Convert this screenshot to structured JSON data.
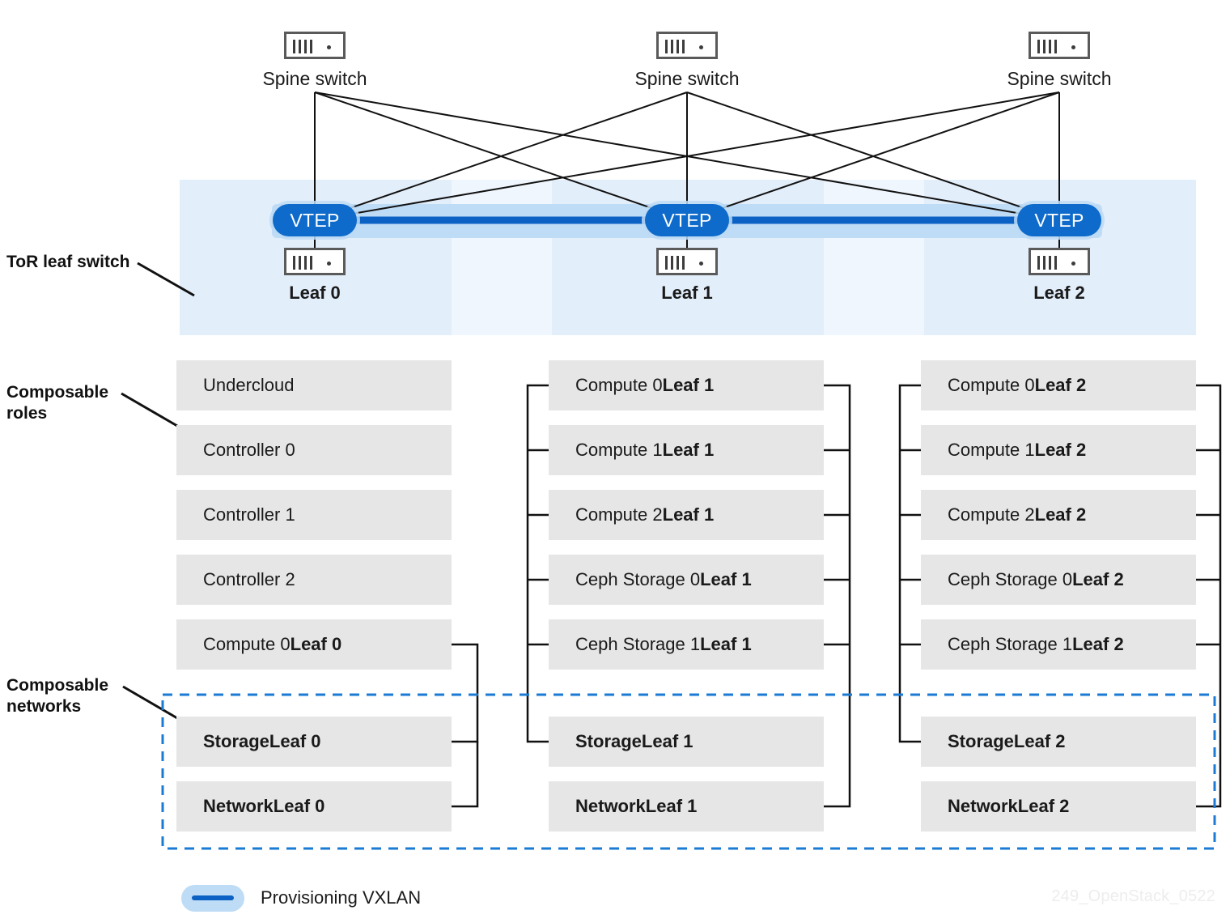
{
  "spine": {
    "icon": "switch-icon",
    "switches": [
      {
        "label": "Spine switch"
      },
      {
        "label": "Spine switch"
      },
      {
        "label": "Spine switch"
      }
    ]
  },
  "leaf": {
    "vtep_label": "VTEP",
    "icon": "switch-icon",
    "switches": [
      {
        "label": "Leaf 0"
      },
      {
        "label": "Leaf 1"
      },
      {
        "label": "Leaf 2"
      }
    ]
  },
  "annotations": {
    "tor": "ToR leaf switch",
    "composable_roles": "Composable\nroles",
    "composable_networks": "Composable\nnetworks"
  },
  "columns": [
    {
      "id": "leaf0",
      "roles": [
        {
          "text": "Undercloud",
          "bold_tail": ""
        },
        {
          "text": "Controller 0",
          "bold_tail": ""
        },
        {
          "text": "Controller 1",
          "bold_tail": ""
        },
        {
          "text": "Controller 2",
          "bold_tail": ""
        },
        {
          "text": "Compute 0 ",
          "bold_tail": "Leaf 0"
        }
      ],
      "networks": [
        {
          "text": "StorageLeaf 0"
        },
        {
          "text": "NetworkLeaf 0"
        }
      ]
    },
    {
      "id": "leaf1",
      "roles": [
        {
          "text": "Compute 0 ",
          "bold_tail": "Leaf 1"
        },
        {
          "text": "Compute 1 ",
          "bold_tail": "Leaf 1"
        },
        {
          "text": "Compute 2 ",
          "bold_tail": "Leaf 1"
        },
        {
          "text": "Ceph Storage 0 ",
          "bold_tail": "Leaf 1"
        },
        {
          "text": "Ceph Storage 1 ",
          "bold_tail": "Leaf 1"
        }
      ],
      "networks": [
        {
          "text": "StorageLeaf 1"
        },
        {
          "text": "NetworkLeaf 1"
        }
      ]
    },
    {
      "id": "leaf2",
      "roles": [
        {
          "text": "Compute 0 ",
          "bold_tail": "Leaf 2"
        },
        {
          "text": "Compute 1 ",
          "bold_tail": "Leaf 2"
        },
        {
          "text": "Compute 2 ",
          "bold_tail": "Leaf 2"
        },
        {
          "text": "Ceph Storage 0 ",
          "bold_tail": "Leaf 2"
        },
        {
          "text": "Ceph Storage 1 ",
          "bold_tail": "Leaf 2"
        }
      ],
      "networks": [
        {
          "text": "StorageLeaf 2"
        },
        {
          "text": "NetworkLeaf 2"
        }
      ]
    }
  ],
  "legend": {
    "label": "Provisioning VXLAN",
    "pill_bg": "#bedcf5",
    "line_color": "#0b62c4"
  },
  "watermark": "249_OpenStack_0522",
  "colors": {
    "vtep_blue": "#0e6bcb",
    "panel_blue": "#e3eefb",
    "band_blue": "#bedcf5",
    "node_gray": "#e6e6e6",
    "dashed_blue": "#1b7bd4",
    "line_black": "#111111"
  }
}
